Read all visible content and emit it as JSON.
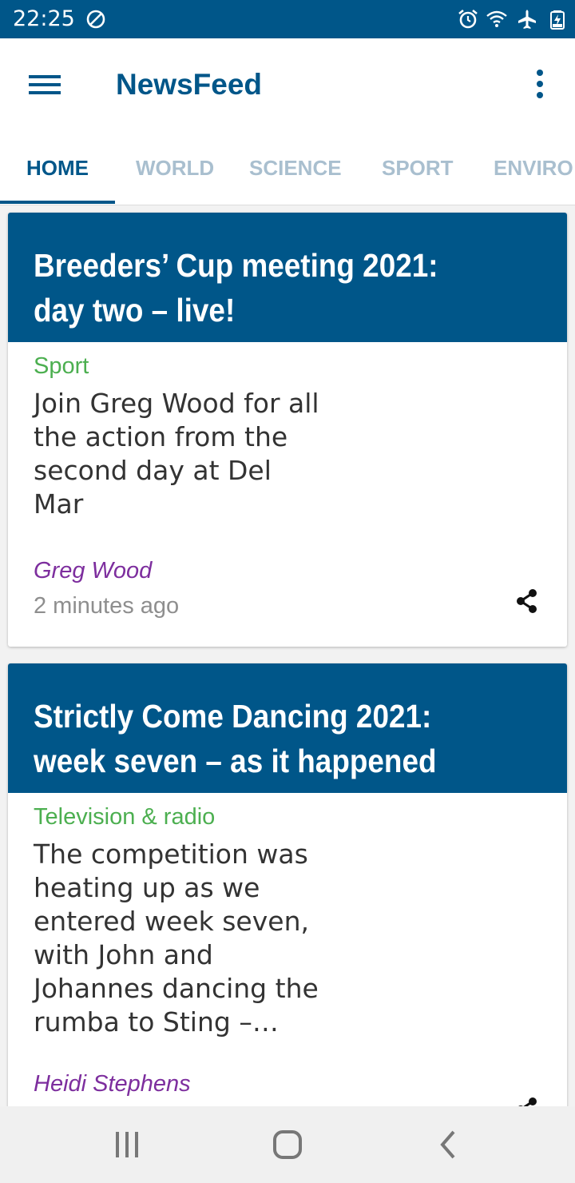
{
  "status_bar": {
    "time": "22:25",
    "icons": [
      "do-not-disturb-icon",
      "alarm-icon",
      "wifi-icon",
      "airplane-mode-icon",
      "battery-charging-icon"
    ],
    "background_color": "#005689"
  },
  "app_bar": {
    "title": "NewsFeed",
    "menu_icon": "hamburger-menu-icon",
    "overflow_icon": "more-vert-icon"
  },
  "tabs": [
    {
      "label": "HOME",
      "selected": true
    },
    {
      "label": "WORLD",
      "selected": false
    },
    {
      "label": "SCIENCE",
      "selected": false
    },
    {
      "label": "SPORT",
      "selected": false
    },
    {
      "label": "ENVIRO",
      "selected": false
    }
  ],
  "articles": [
    {
      "title": "Breeders’ Cup meeting 2021: day two – live!",
      "section": "Sport",
      "trail": "Join Greg Wood for all the action from the second day at Del Mar",
      "byline": "Greg Wood",
      "time": "2 minutes ago",
      "share_icon": "share-icon"
    },
    {
      "title": "Strictly Come Dancing 2021: week seven – as it happened",
      "section": "Television & radio",
      "trail": "The competition was heating up as we entered week seven, with John and Johannes dancing the rumba to Sting –…",
      "byline": "Heidi Stephens",
      "share_icon": "share-icon"
    }
  ],
  "nav_bar": {
    "icons": [
      "recent-apps-icon",
      "home-icon",
      "back-icon"
    ]
  },
  "colors": {
    "primary": "#005689",
    "section": "#4caf50",
    "byline": "#7d2e9e",
    "tab_inactive": "#a9bfcf",
    "timestamp": "#8e8e8e"
  }
}
